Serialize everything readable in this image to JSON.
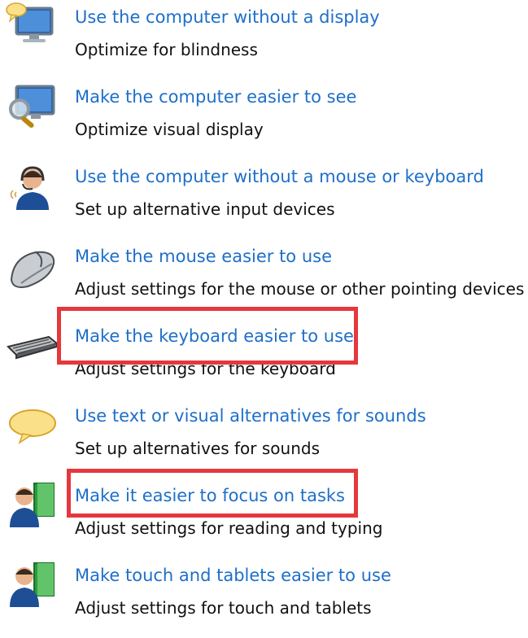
{
  "items": [
    {
      "link": "Use the computer without a display",
      "desc": "Optimize for blindness",
      "icon": "monitor-speech-icon"
    },
    {
      "link": "Make the computer easier to see",
      "desc": "Optimize visual display",
      "icon": "monitor-magnifier-icon"
    },
    {
      "link": "Use the computer without a mouse or keyboard",
      "desc": "Set up alternative input devices",
      "icon": "headset-user-icon"
    },
    {
      "link": "Make the mouse easier to use",
      "desc": "Adjust settings for the mouse or other pointing devices",
      "icon": "mouse-icon"
    },
    {
      "link": "Make the keyboard easier to use",
      "desc": "Adjust settings for the keyboard",
      "icon": "keyboard-icon"
    },
    {
      "link": "Use text or visual alternatives for sounds",
      "desc": "Set up alternatives for sounds",
      "icon": "speech-bubble-icon"
    },
    {
      "link": "Make it easier to focus on tasks",
      "desc": "Adjust settings for reading and typing",
      "icon": "user-book-icon"
    },
    {
      "link": "Make touch and tablets easier to use",
      "desc": "Adjust settings for touch and tablets",
      "icon": "user-book-icon"
    }
  ],
  "colors": {
    "link": "#1e6fc9",
    "highlight": "#e5383d"
  }
}
